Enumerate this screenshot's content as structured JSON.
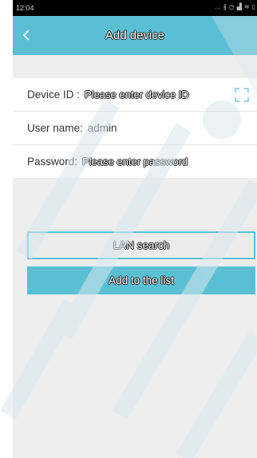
{
  "status_bar": {
    "time": "12:04",
    "icons": [
      "more-dots-icon",
      "bluetooth-icon",
      "alarm-icon",
      "signal-icon",
      "wifi-icon",
      "battery-icon"
    ]
  },
  "header": {
    "title": "Add device",
    "back_icon": "chevron-left-icon"
  },
  "form": {
    "device_id": {
      "label": "Device ID :",
      "placeholder": "Please enter device ID"
    },
    "username": {
      "label": "User name:",
      "value": "admin"
    },
    "password": {
      "label": "Password:",
      "placeholder": "Please enter password"
    },
    "scan_icon": "scan-qr-icon"
  },
  "buttons": {
    "lan_search": "LAN search",
    "add_to_list": "Add to the list"
  },
  "colors": {
    "accent": "#5bbfd4",
    "background": "#eeeeee",
    "status_bar": "#000000"
  }
}
